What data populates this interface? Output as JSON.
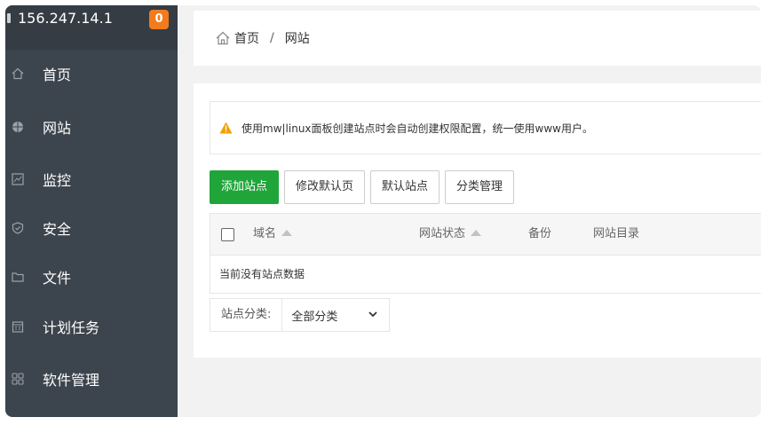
{
  "server": {
    "ip": "156.247.14.1",
    "badge": "0"
  },
  "sidebar": {
    "items": [
      {
        "label": "首页"
      },
      {
        "label": "网站"
      },
      {
        "label": "监控"
      },
      {
        "label": "安全"
      },
      {
        "label": "文件"
      },
      {
        "label": "计划任务"
      },
      {
        "label": "软件管理"
      }
    ]
  },
  "breadcrumb": {
    "home": "首页",
    "separator": "/",
    "current": "网站"
  },
  "alert": {
    "text": "使用mw|linux面板创建站点时会自动创建权限配置，统一使用www用户。"
  },
  "toolbar": {
    "add_site": "添加站点",
    "edit_default": "修改默认页",
    "default_site": "默认站点",
    "category_manage": "分类管理"
  },
  "table": {
    "columns": [
      "域名",
      "网站状态",
      "备份",
      "网站目录"
    ],
    "empty_text": "当前没有站点数据"
  },
  "filter": {
    "label": "站点分类:",
    "selected": "全部分类"
  },
  "colors": {
    "sidebar": "#3c444d",
    "primary": "#20a53a",
    "badge": "#f37b1d",
    "warning": "#f0a000"
  }
}
